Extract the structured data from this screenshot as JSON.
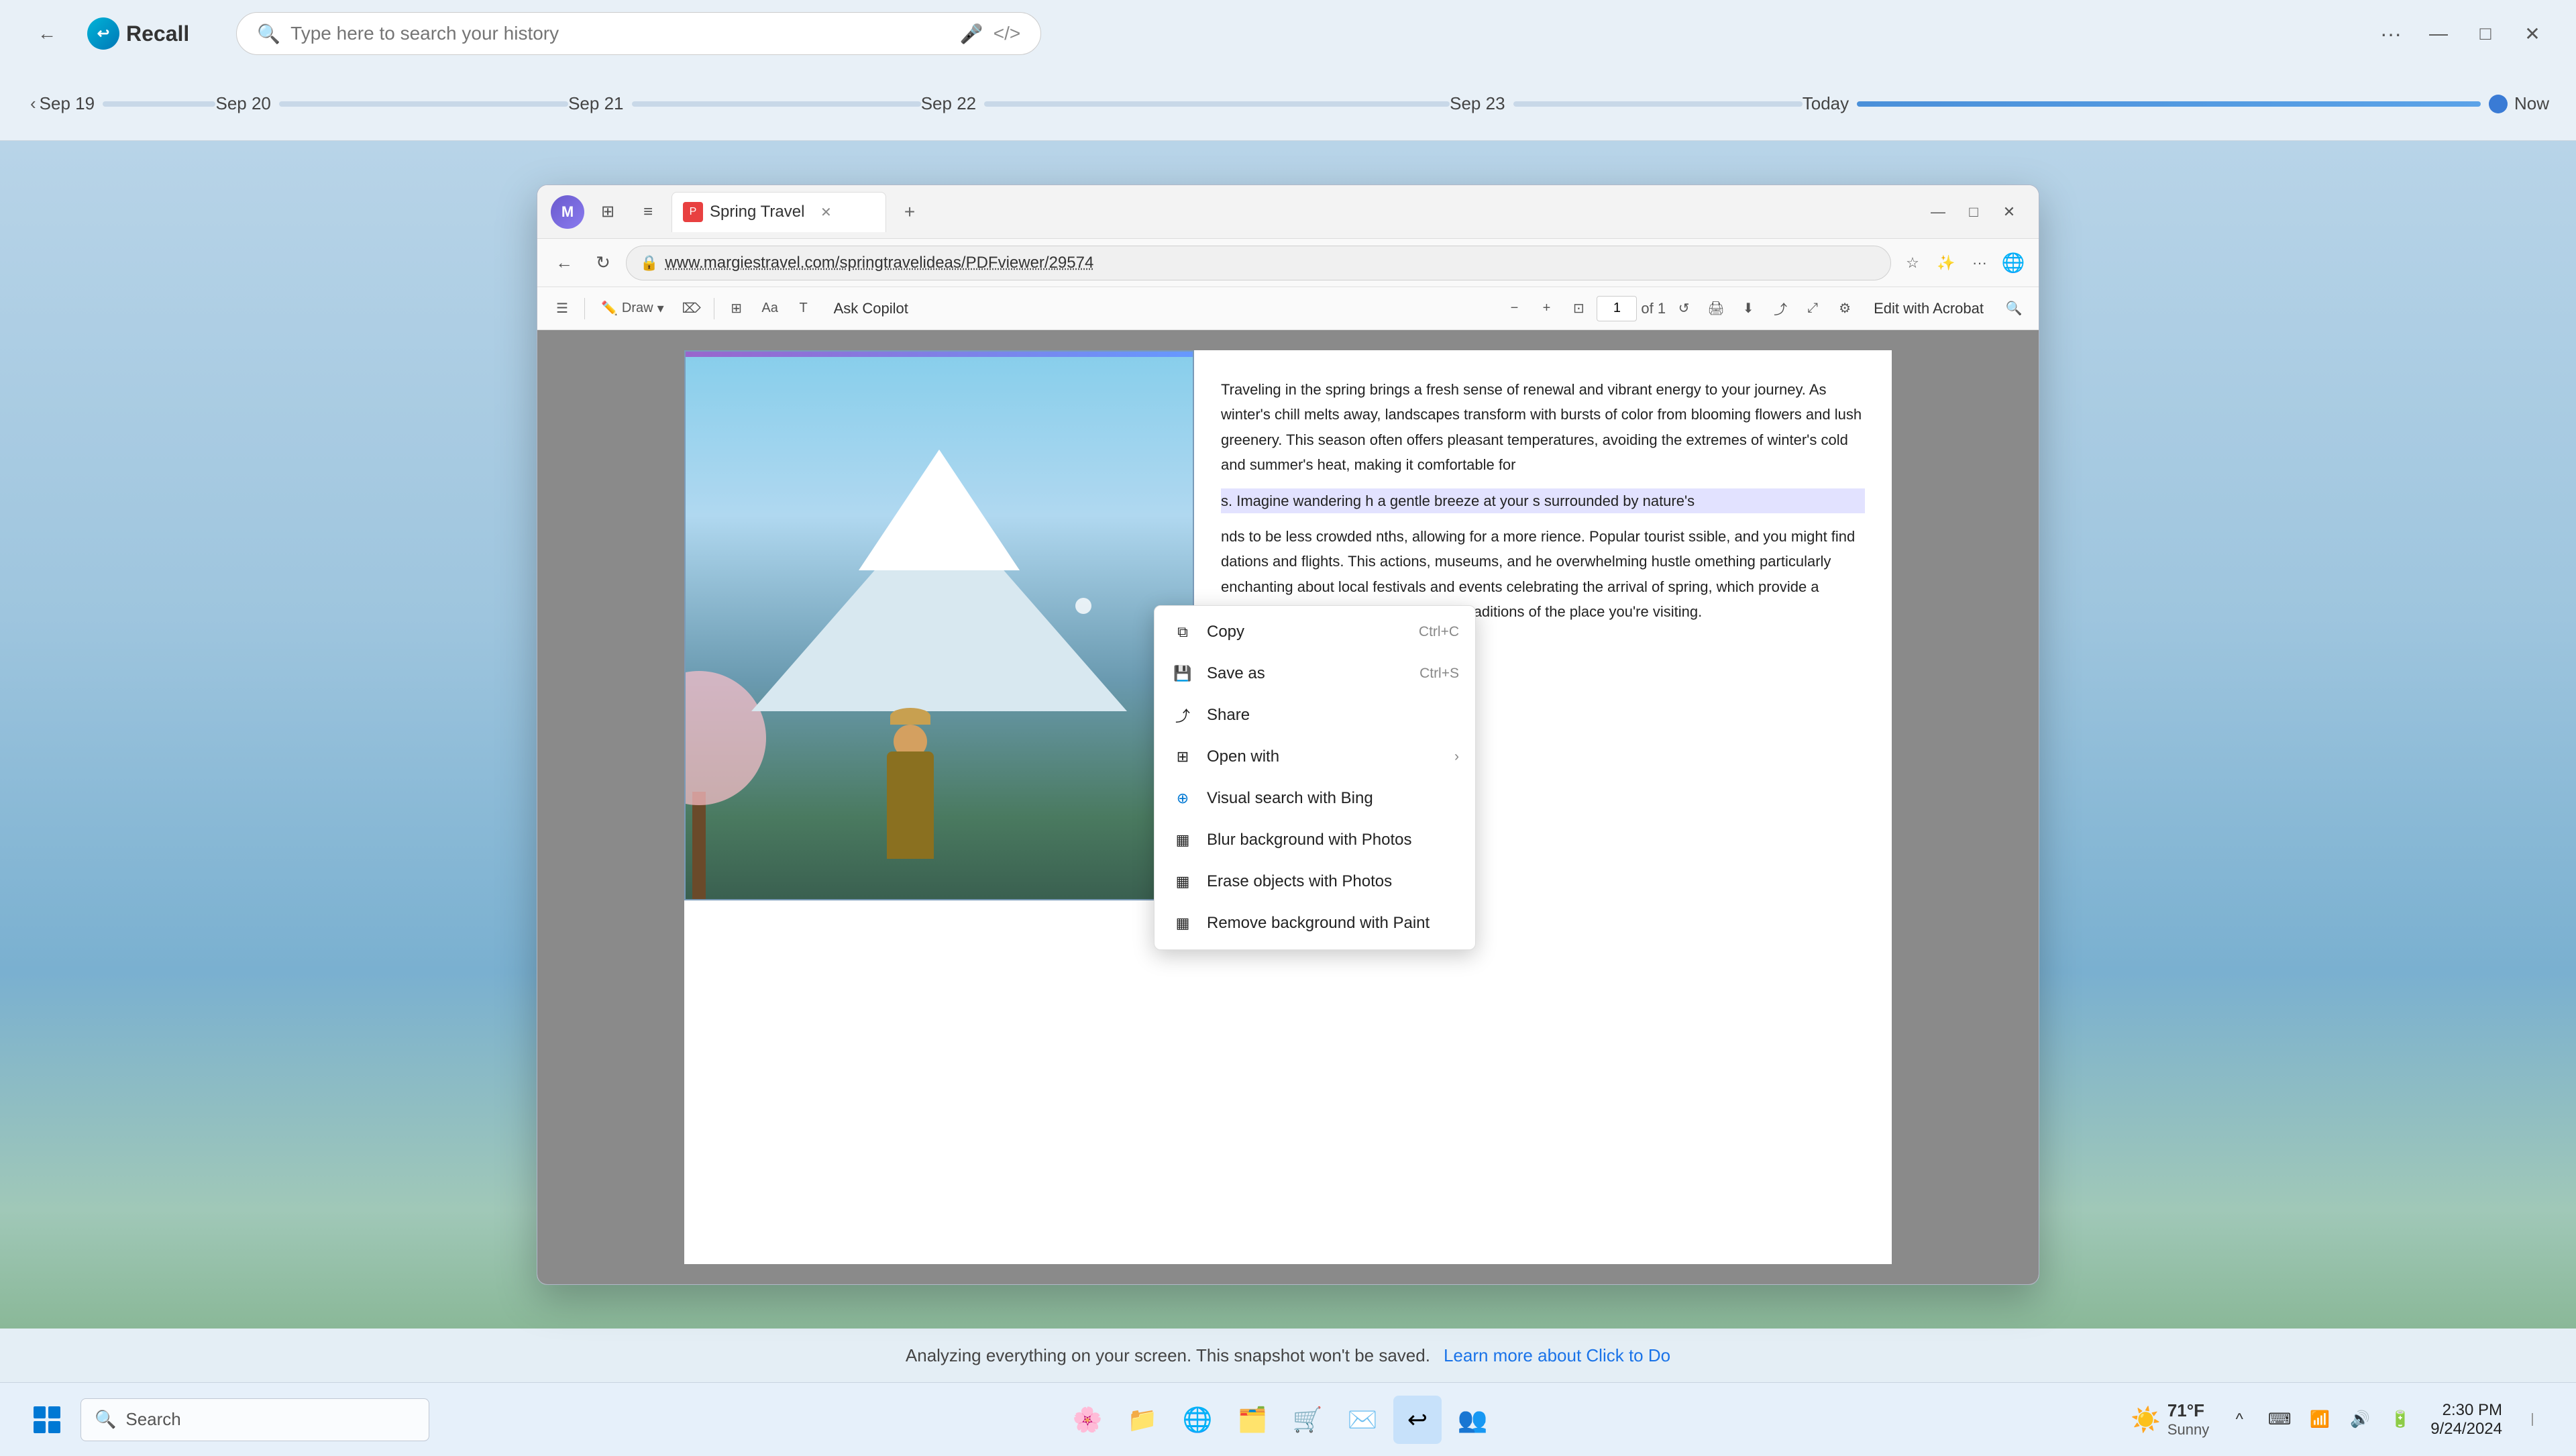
{
  "recall": {
    "back_label": "←",
    "logo_text": "Recall",
    "search_placeholder": "Type here to search your history",
    "dots_label": "···",
    "minimize": "—",
    "maximize": "□",
    "close": "✕"
  },
  "timeline": {
    "sections": [
      {
        "label": "Sep 19",
        "type": "nav"
      },
      {
        "label": "Sep 20",
        "track": true
      },
      {
        "label": "Sep 21",
        "track": true
      },
      {
        "label": "Sep 22",
        "track": true
      },
      {
        "label": "Sep 23",
        "track": true
      },
      {
        "label": "Today",
        "track": true,
        "active": true
      }
    ],
    "now_label": "Now"
  },
  "browser": {
    "tab_title": "Spring Travel",
    "url": "www.margiestravel.com/springtravelideas/PDFviewer/29574",
    "page_number": "1",
    "page_total": "of 1",
    "edit_with_acrobat": "Edit with Acrobat",
    "ask_copilot": "Ask Copilot",
    "draw_label": "Draw"
  },
  "context_menu": {
    "items": [
      {
        "label": "Copy",
        "icon": "⧉",
        "shortcut": "Ctrl+C",
        "has_arrow": false
      },
      {
        "label": "Save as",
        "icon": "💾",
        "shortcut": "Ctrl+S",
        "has_arrow": false
      },
      {
        "label": "Share",
        "icon": "⤴",
        "shortcut": "",
        "has_arrow": false
      },
      {
        "label": "Open with",
        "icon": "⊞",
        "shortcut": "",
        "has_arrow": true
      },
      {
        "label": "Visual search with Bing",
        "icon": "⊕",
        "shortcut": "",
        "has_arrow": false
      },
      {
        "label": "Blur background with Photos",
        "icon": "▦",
        "shortcut": "",
        "has_arrow": false
      },
      {
        "label": "Erase objects with Photos",
        "icon": "▦",
        "shortcut": "",
        "has_arrow": false
      },
      {
        "label": "Remove background with Paint",
        "icon": "▦",
        "shortcut": "",
        "has_arrow": false
      }
    ]
  },
  "pdf_text": {
    "paragraph1": "Traveling in the spring brings a fresh sense of renewal and vibrant energy to your journey. As winter's chill melts away, landscapes transform with bursts of color from blooming flowers and lush greenery. This season often offers pleasant temperatures, avoiding the extremes of winter's cold and summer's heat, making it comfortable for",
    "paragraph1_cont": "s. Imagine wandering h a gentle breeze at your s surrounded by nature's",
    "paragraph2": "nds to be less crowded nths, allowing for a more rience. Popular tourist ssible, and you might find dations and flights. This actions, museums, and he overwhelming hustle omething particularly enchanting about local festivals and events celebrating the arrival of spring, which provide a deeper connection to the culture and traditions of the place you're visiting."
  },
  "bottom_bar": {
    "text": "Analyzing everything on your screen. This snapshot won't be saved.",
    "link_text": "Learn more about Click to Do"
  },
  "taskbar": {
    "search_text": "Search",
    "clock_time": "2:30 PM",
    "clock_date": "9/24/2024",
    "weather_temp": "71°F",
    "weather_desc": "Sunny"
  }
}
